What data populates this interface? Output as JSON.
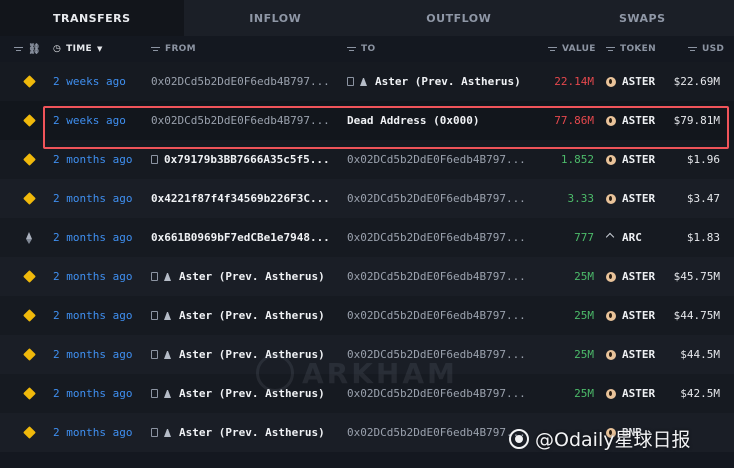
{
  "tabs": [
    {
      "label": "TRANSFERS",
      "active": true
    },
    {
      "label": "INFLOW",
      "active": false
    },
    {
      "label": "OUTFLOW",
      "active": false
    },
    {
      "label": "SWAPS",
      "active": false
    }
  ],
  "columns": {
    "time": "TIME",
    "from": "FROM",
    "to": "TO",
    "value": "VALUE",
    "token": "TOKEN",
    "usd": "USD"
  },
  "rows": [
    {
      "chain": "bnb-icon",
      "time": "2 weeks ago",
      "from": "0x02DCd5b2DdE0F6edb4B797...",
      "to": "Aster (Prev. Astherus)",
      "value": "22.14M",
      "value_sign": "neg",
      "token": "ASTER",
      "token_icon": "aster-icon",
      "usd": "$22.69M"
    },
    {
      "chain": "bnb-icon",
      "time": "2 weeks ago",
      "from": "0x02DCd5b2DdE0F6edb4B797...",
      "to": "Dead Address (0x000)",
      "value": "77.86M",
      "value_sign": "neg",
      "token": "ASTER",
      "token_icon": "aster-icon",
      "usd": "$79.81M"
    },
    {
      "chain": "bnb-icon",
      "time": "2 months ago",
      "from": "0x79179b3BB7666A35c5f5...",
      "to": "0x02DCd5b2DdE0F6edb4B797...",
      "value": "1.852",
      "value_sign": "pos",
      "token": "ASTER",
      "token_icon": "aster-icon",
      "usd": "$1.96"
    },
    {
      "chain": "bnb-icon",
      "time": "2 months ago",
      "from": "0x4221f87f4f34569b226F3C...",
      "to": "0x02DCd5b2DdE0F6edb4B797...",
      "value": "3.33",
      "value_sign": "pos",
      "token": "ASTER",
      "token_icon": "aster-icon",
      "usd": "$3.47"
    },
    {
      "chain": "eth-icon",
      "time": "2 months ago",
      "from": "0x661B0969bF7edCBe1e7948...",
      "to": "0x02DCd5b2DdE0F6edb4B797...",
      "value": "777",
      "value_sign": "pos",
      "token": "ARC",
      "token_icon": "arc-icon",
      "usd": "$1.83"
    },
    {
      "chain": "bnb-icon",
      "time": "2 months ago",
      "from": "Aster (Prev. Astherus)",
      "to": "0x02DCd5b2DdE0F6edb4B797...",
      "value": "25M",
      "value_sign": "pos",
      "token": "ASTER",
      "token_icon": "aster-icon",
      "usd": "$45.75M"
    },
    {
      "chain": "bnb-icon",
      "time": "2 months ago",
      "from": "Aster (Prev. Astherus)",
      "to": "0x02DCd5b2DdE0F6edb4B797...",
      "value": "25M",
      "value_sign": "pos",
      "token": "ASTER",
      "token_icon": "aster-icon",
      "usd": "$44.75M"
    },
    {
      "chain": "bnb-icon",
      "time": "2 months ago",
      "from": "Aster (Prev. Astherus)",
      "to": "0x02DCd5b2DdE0F6edb4B797...",
      "value": "25M",
      "value_sign": "pos",
      "token": "ASTER",
      "token_icon": "aster-icon",
      "usd": "$44.5M"
    },
    {
      "chain": "bnb-icon",
      "time": "2 months ago",
      "from": "Aster (Prev. Astherus)",
      "to": "0x02DCd5b2DdE0F6edb4B797...",
      "value": "25M",
      "value_sign": "pos",
      "token": "ASTER",
      "token_icon": "aster-icon",
      "usd": "$42.5M"
    },
    {
      "chain": "bnb-icon",
      "time": "2 months ago",
      "from": "Aster (Prev. Astherus)",
      "to": "0x02DCd5b2DdE0F6edb4B797...",
      "value": "",
      "value_sign": "pos",
      "token": "BNB",
      "token_icon": "aster-icon",
      "usd": ""
    }
  ],
  "watermark": "ARKHAM",
  "credit": "@Odaily星球日报",
  "colors": {
    "highlight_border": "#f0545a",
    "negative": "#e5484d",
    "positive": "#4cbb6a",
    "link": "#3f8ff0"
  }
}
